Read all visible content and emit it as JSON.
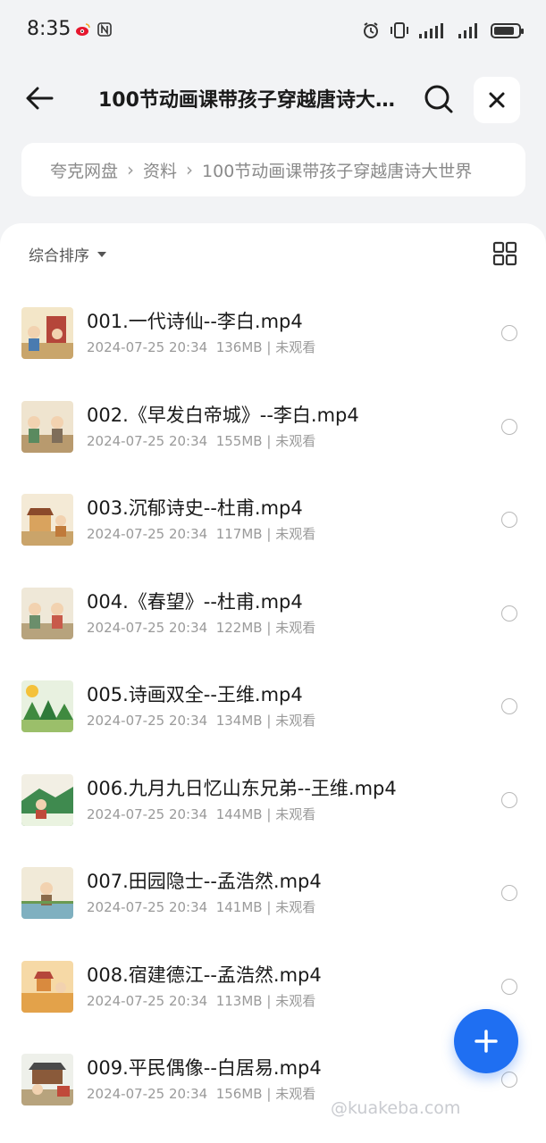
{
  "status_bar": {
    "time": "8:35",
    "left_icons": [
      "weibo-icon",
      "nfc-icon"
    ],
    "right_icons": [
      "alarm-icon",
      "vibrate-icon",
      "signal-icon",
      "signal-icon",
      "battery-icon"
    ],
    "battery_level": 0.85
  },
  "header": {
    "title": "100节动画课带孩子穿越唐诗大世界",
    "back_icon": "arrow-left-icon",
    "search_icon": "search-icon",
    "close_icon": "close-icon"
  },
  "breadcrumb": {
    "items": [
      "夸克网盘",
      "资料",
      "100节动画课带孩子穿越唐诗大世界"
    ]
  },
  "toolbar": {
    "sort_label": "综合排序",
    "grid_icon": "grid-view-icon"
  },
  "files": [
    {
      "name": "001.一代诗仙--李白.mp4",
      "date": "2024-07-25 20:34",
      "size": "136MB",
      "status": "未观看"
    },
    {
      "name": "002.《早发白帝城》--李白.mp4",
      "date": "2024-07-25 20:34",
      "size": "155MB",
      "status": "未观看"
    },
    {
      "name": "003.沉郁诗史--杜甫.mp4",
      "date": "2024-07-25 20:34",
      "size": "117MB",
      "status": "未观看"
    },
    {
      "name": "004.《春望》--杜甫.mp4",
      "date": "2024-07-25 20:34",
      "size": "122MB",
      "status": "未观看"
    },
    {
      "name": "005.诗画双全--王维.mp4",
      "date": "2024-07-25 20:34",
      "size": "134MB",
      "status": "未观看"
    },
    {
      "name": "006.九月九日忆山东兄弟--王维.mp4",
      "date": "2024-07-25 20:34",
      "size": "144MB",
      "status": "未观看"
    },
    {
      "name": "007.田园隐士--孟浩然.mp4",
      "date": "2024-07-25 20:34",
      "size": "141MB",
      "status": "未观看"
    },
    {
      "name": "008.宿建德江--孟浩然.mp4",
      "date": "2024-07-25 20:34",
      "size": "113MB",
      "status": "未观看"
    },
    {
      "name": "009.平民偶像--白居易.mp4",
      "date": "2024-07-25 20:34",
      "size": "156MB",
      "status": "未观看"
    }
  ],
  "fab": {
    "icon": "plus-icon",
    "color": "#1f6ff2"
  },
  "watermark": "@kuakeba.com"
}
